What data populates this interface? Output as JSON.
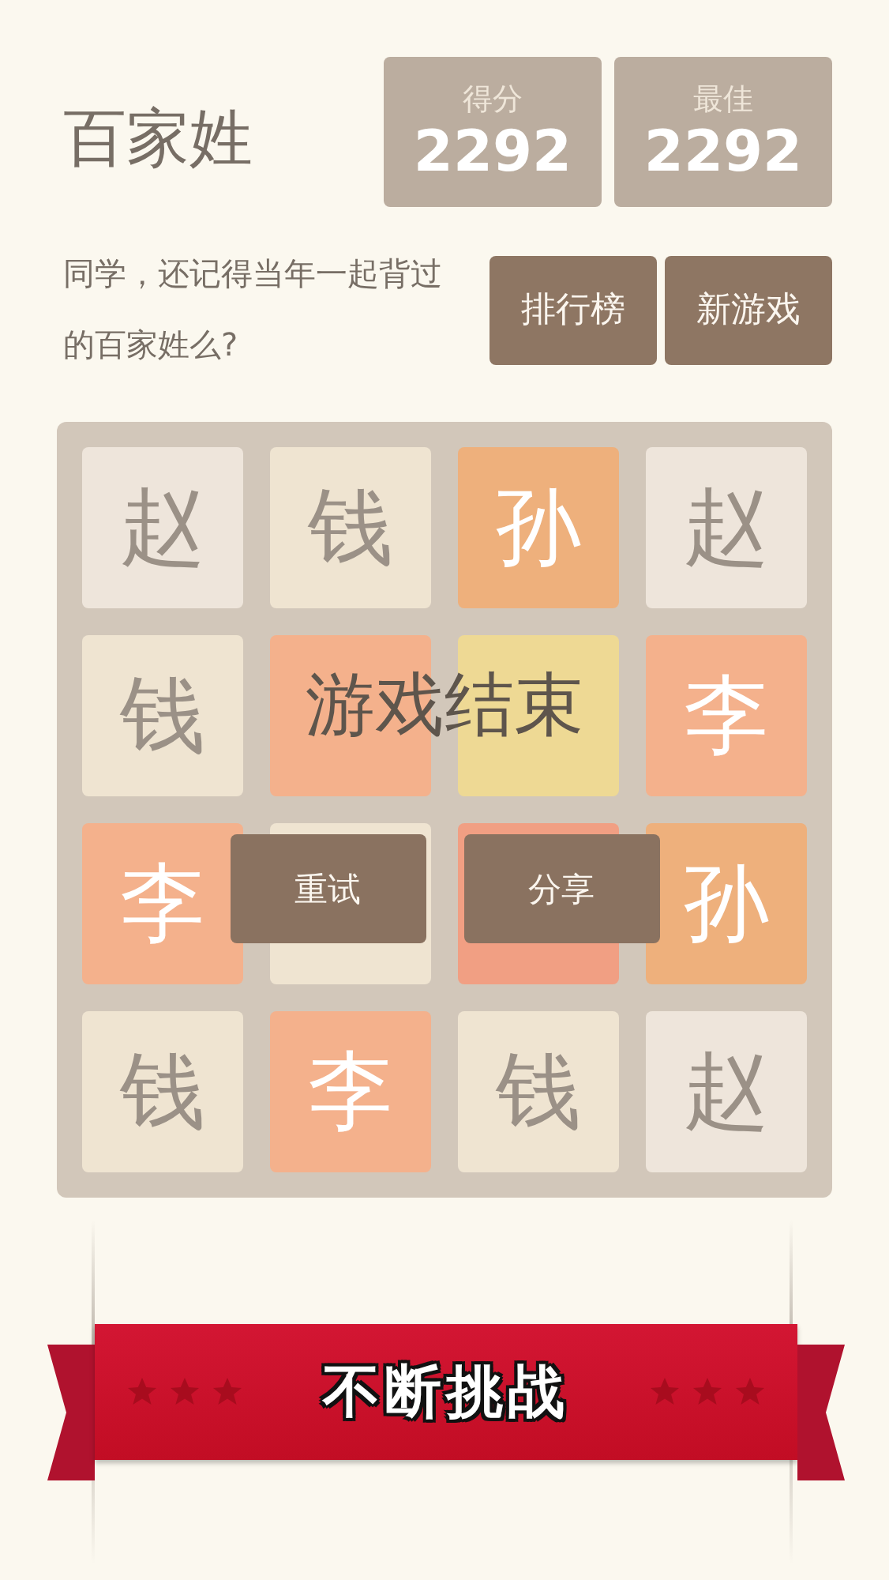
{
  "header": {
    "title": "百家姓",
    "scores": [
      {
        "label": "得分",
        "value": "2292"
      },
      {
        "label": "最佳",
        "value": "2292"
      }
    ]
  },
  "intro": "同学，还记得当年一起背过的百家姓么?",
  "buttons": [
    "排行榜",
    "新游戏"
  ],
  "board": {
    "rows": [
      [
        {
          "char": "赵",
          "kind": "pale",
          "color": "#eee5db"
        },
        {
          "char": "钱",
          "kind": "pale",
          "color": "#efe4d1"
        },
        {
          "char": "孙",
          "kind": "warm",
          "color": "#eeb07c"
        },
        {
          "char": "赵",
          "kind": "pale",
          "color": "#eee5db"
        }
      ],
      [
        {
          "char": "钱",
          "kind": "pale",
          "color": "#efe4d1"
        },
        {
          "kind": "warm",
          "color": "#f4b18c"
        },
        {
          "kind": "warm",
          "color": "#eed994"
        },
        {
          "char": "李",
          "kind": "warm",
          "color": "#f4b18c"
        }
      ],
      [
        {
          "char": "李",
          "kind": "warm",
          "color": "#f4b18c"
        },
        {
          "kind": "pale",
          "color": "#efe4d1"
        },
        {
          "kind": "warm",
          "color": "#f19f83"
        },
        {
          "char": "孙",
          "kind": "warm",
          "color": "#eeb07c"
        }
      ],
      [
        {
          "char": "钱",
          "kind": "pale",
          "color": "#efe4d1"
        },
        {
          "char": "李",
          "kind": "warm",
          "color": "#f4b18c"
        },
        {
          "char": "钱",
          "kind": "pale",
          "color": "#efe4d1"
        },
        {
          "char": "赵",
          "kind": "pale",
          "color": "#eee5db"
        }
      ]
    ]
  },
  "game_over": {
    "message": "游戏结束",
    "buttons": [
      "重试",
      "分享"
    ]
  },
  "banner": {
    "text": "不断挑战"
  }
}
